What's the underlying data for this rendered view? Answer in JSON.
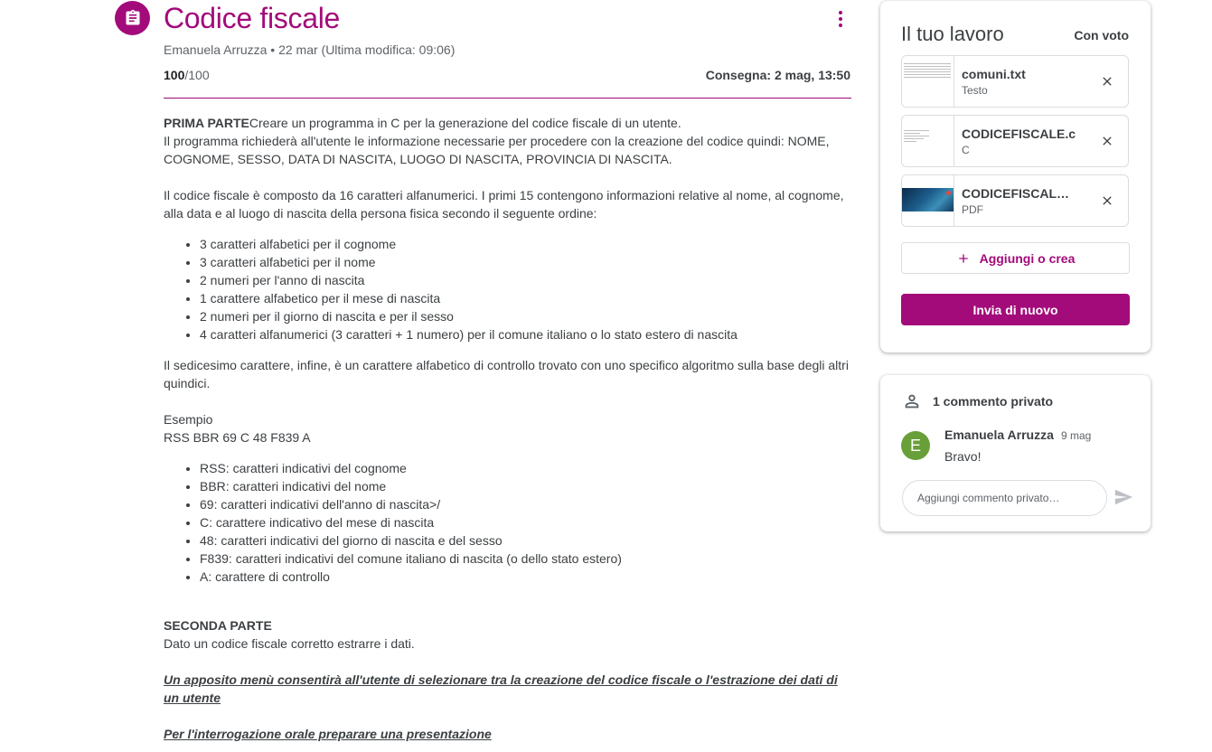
{
  "assignment": {
    "title": "Codice fiscale",
    "meta": "Emanuela Arruzza • 22 mar (Ultima modifica: 09:06)",
    "points_earned": "100",
    "points_total": "/100",
    "due": "Consegna: 2 mag, 13:50",
    "accent_color": "#a30b7a"
  },
  "description": {
    "part1_heading": "PRIMA PARTE",
    "part1_intro": "Creare un programma in C per la generazione del codice fiscale di un utente.",
    "part1_p2": "Il programma richiederà all'utente le informazione necessarie per procedere con la creazione del codice quindi: NOME, COGNOME, SESSO, DATA DI NASCITA, LUOGO DI NASCITA, PROVINCIA DI NASCITA.",
    "part1_p3": "Il codice fiscale è composto da 16 caratteri alfanumerici. I primi 15 contengono informazioni relative al nome, al cognome, alla data e al luogo di nascita della persona fisica secondo il seguente ordine:",
    "list1": [
      "3 caratteri alfabetici per il cognome",
      "3 caratteri alfabetici per il nome",
      "2 numeri per l'anno di nascita",
      "1 carattere alfabetico per il mese di nascita",
      "2 numeri per il giorno di nascita e per il sesso",
      "4 caratteri alfanumerici (3 caratteri + 1 numero) per il comune italiano o lo stato estero di nascita"
    ],
    "part1_p4": "Il sedicesimo carattere, infine, è un carattere alfabetico di controllo trovato con uno specifico algoritmo sulla base degli altri quindici.",
    "example_label": "Esempio",
    "example_code": "RSS BBR 69 C 48 F839 A",
    "list2": [
      "RSS: caratteri indicativi del cognome",
      "BBR: caratteri indicativi del nome",
      "69: caratteri indicativi dell'anno di nascita>/",
      "C: carattere indicativo del mese di nascita",
      "48: caratteri indicativi del giorno di nascita e del sesso",
      "F839: caratteri indicativi del comune italiano di nascita (o dello stato estero)",
      "A: carattere di controllo"
    ],
    "part2_heading": "SECONDA PARTE",
    "part2_text": "Dato un codice fiscale corretto estrarre i dati.",
    "note1": "Un apposito menù consentirà all'utente di selezionare tra la creazione del codice fiscale o l'estrazione dei dati di un utente",
    "note2": "Per l'interrogazione orale preparare una presentazione"
  },
  "your_work": {
    "title": "Il tuo lavoro",
    "status": "Con voto",
    "attachments": [
      {
        "name": "comuni.txt",
        "type": "Testo"
      },
      {
        "name": "CODICEFISCALE.c",
        "type": "C"
      },
      {
        "name": "CODICEFISCALE.…",
        "type": "PDF"
      }
    ],
    "add_label": "Aggiungi o crea",
    "submit_label": "Invia di nuovo"
  },
  "comments": {
    "header": "1 commento privato",
    "items": [
      {
        "initial": "E",
        "author": "Emanuela Arruzza",
        "date": "9 mag",
        "text": "Bravo!"
      }
    ],
    "input_placeholder": "Aggiungi commento privato…"
  }
}
